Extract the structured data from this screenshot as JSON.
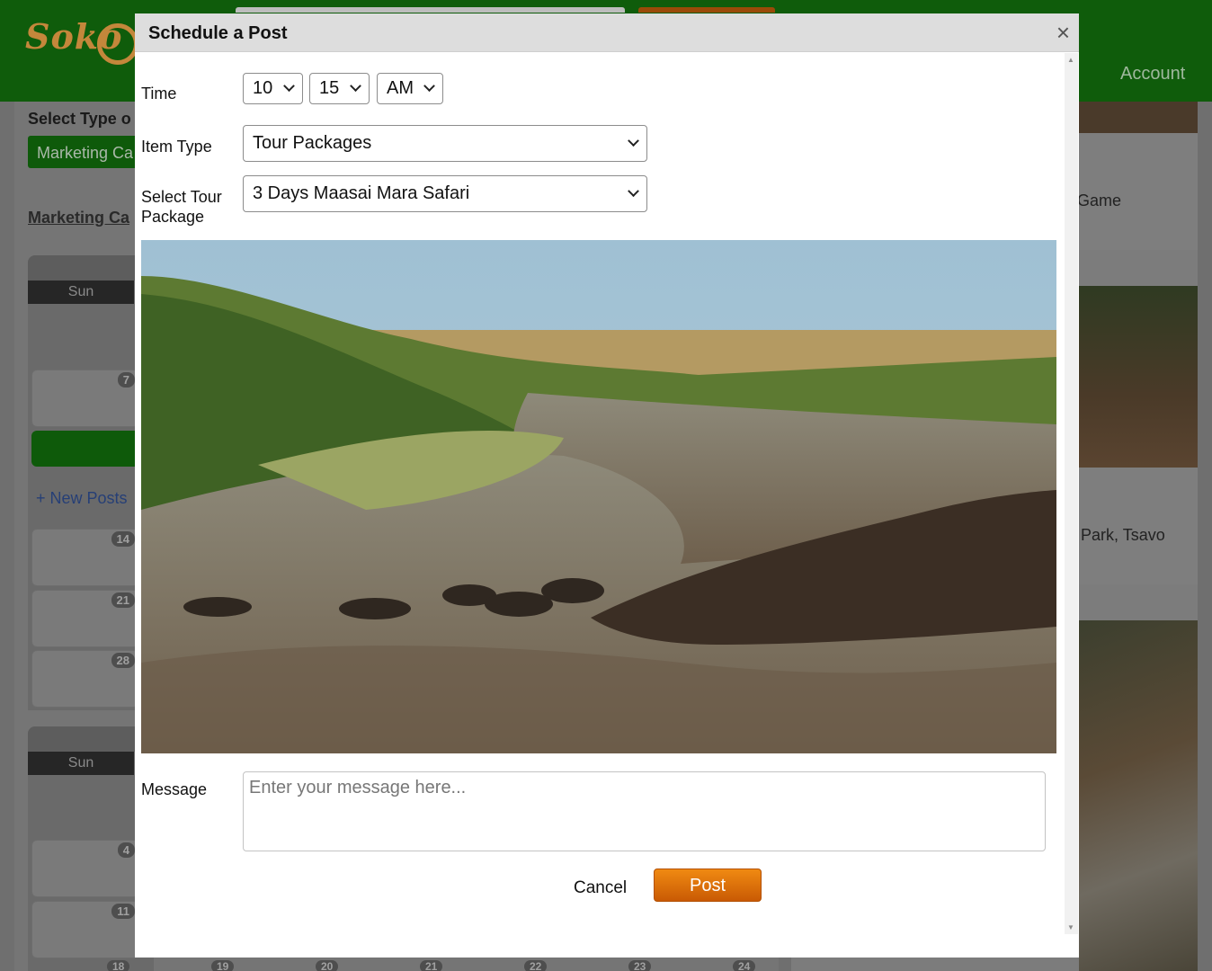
{
  "background": {
    "logo_text": "Soko",
    "account_label": "Account",
    "select_type_label": "Select Type o",
    "marketing_button": "Marketing Ca",
    "marketing_link": "Marketing Ca",
    "calendar_1": {
      "sun": "Sun",
      "days": [
        "7",
        "14",
        "21",
        "28"
      ],
      "new_posts": "+ New Posts"
    },
    "calendar_2": {
      "sun": "Sun",
      "days": [
        "4",
        "11"
      ]
    },
    "bottom_days": [
      "18",
      "19",
      "20",
      "21",
      "22",
      "23",
      "24"
    ],
    "right_texts": [
      "Game",
      "Park, Tsavo"
    ]
  },
  "modal": {
    "title": "Schedule a Post",
    "close_label": "×",
    "time_label": "Time",
    "time": {
      "hour": "10",
      "minute": "15",
      "ampm": "AM"
    },
    "item_type_label": "Item Type",
    "item_type_value": "Tour Packages",
    "tour_package_label": "Select Tour Package",
    "tour_package_value": "3 Days Maasai Mara Safari",
    "photo_icon": "safari-photo",
    "message_label": "Message",
    "message_placeholder": "Enter your message here...",
    "message_value": "",
    "cancel_label": "Cancel",
    "post_label": "Post"
  },
  "colors": {
    "header_green": "#0f5c0b",
    "post_orange": "#e07a0b"
  }
}
